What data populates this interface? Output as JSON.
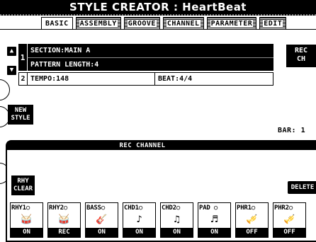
{
  "title": "STYLE CREATOR : HeartBeat",
  "tabs": [
    {
      "label": "BASIC",
      "active": true
    },
    {
      "label": "ASSEMBLY",
      "active": false
    },
    {
      "label": "GROOVE",
      "active": false
    },
    {
      "label": "CHANNEL",
      "active": false
    },
    {
      "label": "PARAMETER",
      "active": false
    },
    {
      "label": "EDIT",
      "active": false
    }
  ],
  "params": {
    "row1_num": "1",
    "section": "SECTION:MAIN A",
    "pattern_length": "PATTERN LENGTH:4",
    "row2_num": "2",
    "tempo": "TEMPO:148",
    "beat": "BEAT:4/4"
  },
  "buttons": {
    "rec_ch_line1": "REC",
    "rec_ch_line2": "CH",
    "new_style_line1": "NEW",
    "new_style_line2": "STYLE",
    "rhy_clear_line1": "RHY",
    "rhy_clear_line2": "CLEAR",
    "delete": "DELETE",
    "up_icon": "up-arrow-icon",
    "down_icon": "down-arrow-icon"
  },
  "bar_label": "BAR: 1",
  "rec_channel": {
    "header": "REC CHANNEL",
    "channels": [
      {
        "label": "RHY1○",
        "icon": "drum-kit-icon",
        "status": "ON"
      },
      {
        "label": "RHY2○",
        "icon": "drum-kit-icon",
        "status": "REC"
      },
      {
        "label": "BASS○",
        "icon": "bass-guitar-icon",
        "status": "ON"
      },
      {
        "label": "CHD1○",
        "icon": "acoustic-guitar-icon",
        "status": "ON"
      },
      {
        "label": "CHD2○",
        "icon": "electric-guitar-icon",
        "status": "ON"
      },
      {
        "label": "PAD ○",
        "icon": "strings-icon",
        "status": "ON"
      },
      {
        "label": "PHR1○",
        "icon": "brass-icon",
        "status": "OFF"
      },
      {
        "label": "PHR2○",
        "icon": "brass-icon",
        "status": "OFF"
      }
    ]
  },
  "colors": {
    "background": "#ffffff",
    "foreground": "#000000"
  }
}
